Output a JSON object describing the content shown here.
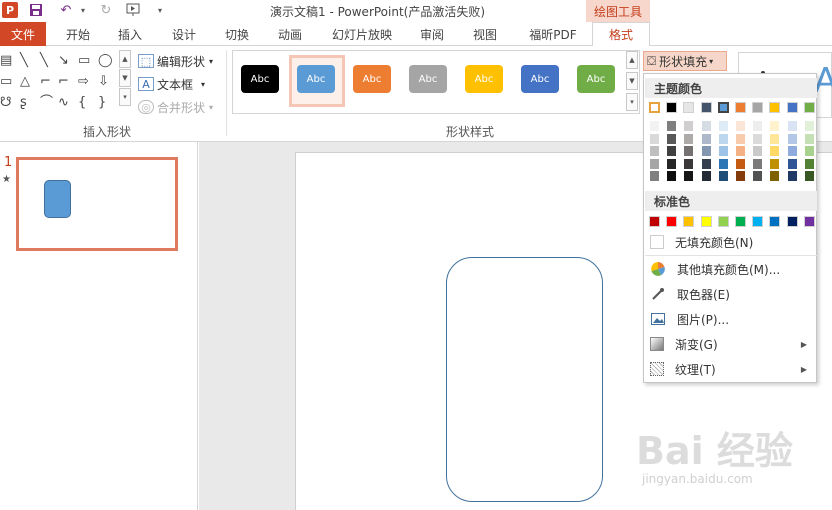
{
  "titlebar": {
    "title": "演示文稿1 - PowerPoint(产品激活失败)",
    "contextual_tab_group": "绘图工具",
    "app_logo": "P"
  },
  "tabs": [
    "文件",
    "开始",
    "插入",
    "设计",
    "切换",
    "动画",
    "幻灯片放映",
    "审阅",
    "视图",
    "福昕PDF",
    "格式"
  ],
  "ribbon": {
    "insert_shapes": {
      "label": "插入形状",
      "edit_shape": "编辑形状",
      "text_box": "文本框",
      "merge_shapes": "合并形状"
    },
    "shape_styles": {
      "label": "形状样式",
      "preview_text": "Abc",
      "styles": [
        {
          "fill": "#000000",
          "text": "#ffffff"
        },
        {
          "fill": "#5b9bd5",
          "text": "#ffffff"
        },
        {
          "fill": "#ed7d31",
          "text": "#ffffff"
        },
        {
          "fill": "#a5a5a5",
          "text": "#ffffff"
        },
        {
          "fill": "#ffc000",
          "text": "#ffffff"
        },
        {
          "fill": "#4472c4",
          "text": "#ffffff"
        },
        {
          "fill": "#70ad47",
          "text": "#ffffff"
        }
      ],
      "selected_index": 1
    },
    "shape_fill": "形状填充"
  },
  "thumbnails": {
    "slide_number": "1",
    "star": "★"
  },
  "dropdown": {
    "theme_colors_label": "主题颜色",
    "standard_colors_label": "标准色",
    "theme_top_row": [
      "#ffffff",
      "#000000",
      "#e7e6e6",
      "#44546a",
      "#5b9bd5",
      "#ed7d31",
      "#a5a5a5",
      "#ffc000",
      "#4472c4",
      "#70ad47"
    ],
    "theme_shades": [
      [
        "#f2f2f2",
        "#d9d9d9",
        "#bfbfbf",
        "#a6a6a6",
        "#808080"
      ],
      [
        "#7f7f7f",
        "#595959",
        "#404040",
        "#262626",
        "#0d0d0d"
      ],
      [
        "#d0cece",
        "#aeaaaa",
        "#757171",
        "#3a3838",
        "#171616"
      ],
      [
        "#d6dce4",
        "#adb9ca",
        "#8497b0",
        "#333f4f",
        "#222a35"
      ],
      [
        "#ddebf7",
        "#bdd7ee",
        "#9dc3e6",
        "#2e75b6",
        "#1f4e79"
      ],
      [
        "#fbe5d6",
        "#f8cbad",
        "#f4b183",
        "#c55a11",
        "#843c0c"
      ],
      [
        "#ededed",
        "#dbdbdb",
        "#c9c9c9",
        "#7b7b7b",
        "#525252"
      ],
      [
        "#fff2cc",
        "#ffe699",
        "#ffd966",
        "#bf9000",
        "#7f6000"
      ],
      [
        "#dae3f3",
        "#b4c7e7",
        "#8faadc",
        "#2f5597",
        "#203864"
      ],
      [
        "#e2f0d9",
        "#c5e0b4",
        "#a9d18e",
        "#548235",
        "#385723"
      ]
    ],
    "standard_colors": [
      "#c00000",
      "#ff0000",
      "#ffc000",
      "#ffff00",
      "#92d050",
      "#00b050",
      "#00b0f0",
      "#0070c0",
      "#002060",
      "#7030a0"
    ],
    "items": {
      "no_fill": "无填充颜色(N)",
      "more_colors": "其他填充颜色(M)...",
      "eyedropper": "取色器(E)",
      "picture": "图片(P)...",
      "gradient": "渐变(G)",
      "texture": "纹理(T)"
    }
  },
  "watermark": {
    "main": "Bai 经验",
    "sub": "jingyan.baidu.com"
  }
}
